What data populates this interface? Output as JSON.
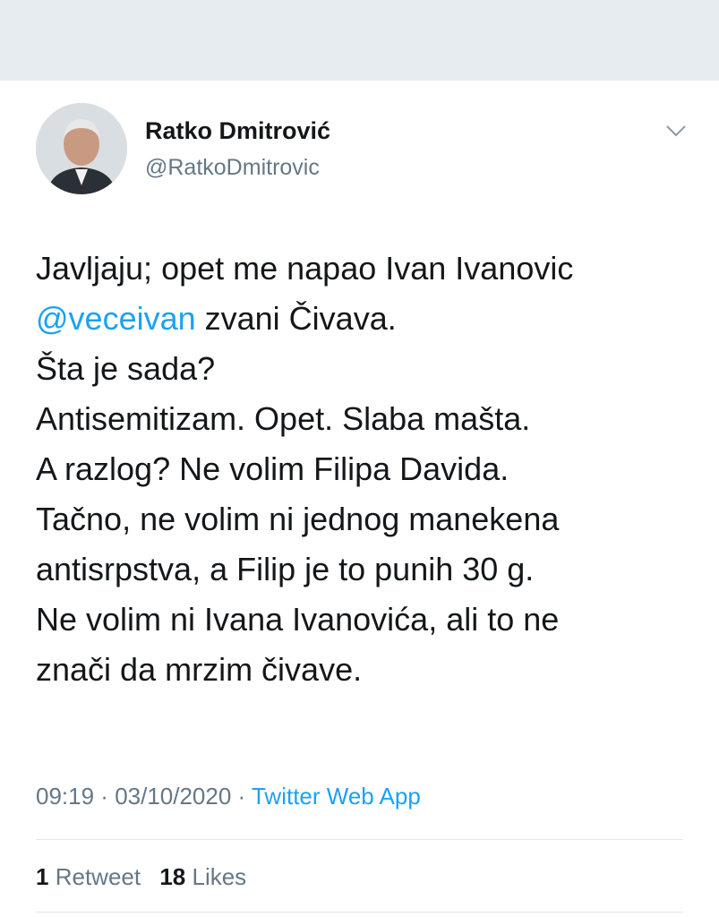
{
  "author": {
    "name": "Ratko Dmitrović",
    "handle": "@RatkoDmitrovic"
  },
  "tweet": {
    "line1": "Javljaju; opet me napao Ivan Ivanovic",
    "mention": "@veceivan",
    "line2_rest": " zvani Čivava.",
    "line3": "Šta je sada?",
    "line4": "Antisemitizam. Opet. Slaba mašta.",
    "line5": "A razlog? Ne volim Filipa Davida.",
    "line6": "Tačno, ne volim ni jednog manekena",
    "line7": "antisrpstva, a Filip je to punih 30 g.",
    "line8": "Ne volim ni Ivana Ivanovića, ali to ne",
    "line9": "znači da mrzim čivave."
  },
  "meta": {
    "time": "09:19",
    "sep1": " · ",
    "date": "03/10/2020",
    "sep2": " · ",
    "source": "Twitter Web App"
  },
  "stats": {
    "retweets_count": "1",
    "retweets_label": "Retweet",
    "likes_count": "18",
    "likes_label": "Likes"
  },
  "icons": {
    "menu": "chevron-down-icon"
  },
  "colors": {
    "link": "#1da1f2",
    "secondary_text": "#657786",
    "primary_text": "#14171a",
    "top_bar": "#e6ecf0"
  }
}
